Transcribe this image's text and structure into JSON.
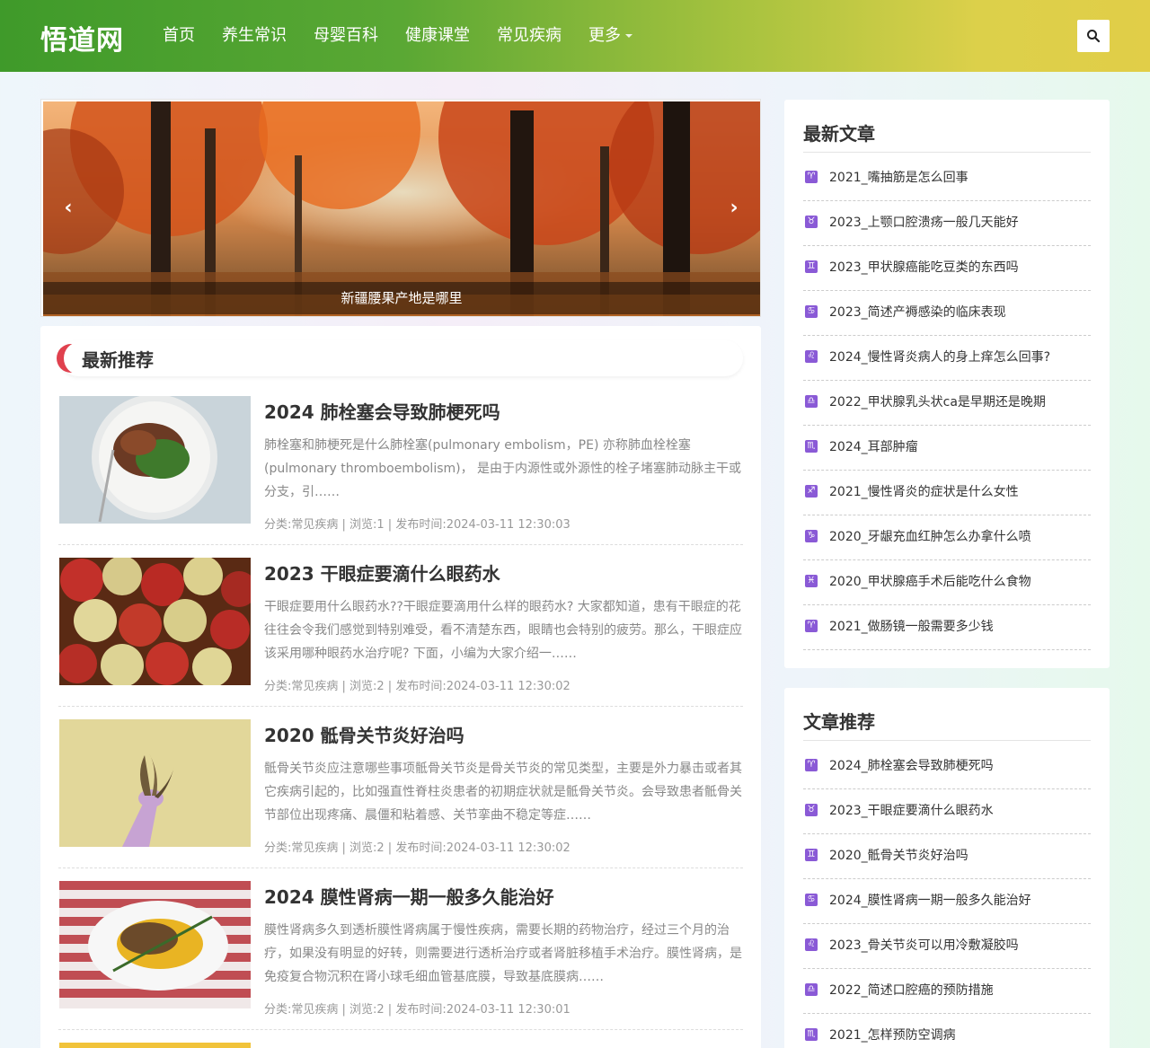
{
  "site": {
    "logo": "悟道网",
    "nav": [
      "首页",
      "养生常识",
      "母婴百科",
      "健康课堂",
      "常见疾病",
      "更多"
    ],
    "search_icon": "search-icon",
    "accent": "#e0414e",
    "header_gradient": [
      "#3f9a2a",
      "#e1ce48"
    ]
  },
  "slider": {
    "caption": "新疆腰果产地是哪里"
  },
  "main": {
    "section_title": "最新推荐",
    "posts": [
      {
        "title": "2024 肺栓塞会导致肺梗死吗",
        "excerpt": "肺栓塞和肺梗死是什么肺栓塞(pulmonary embolism，PE) 亦称肺血栓栓塞(pulmonary thromboembolism)， 是由于内源性或外源性的栓子堵塞肺动脉主干或分支，引……",
        "meta": "分类:常见疾病 | 浏览:1 | 发布时间:2024-03-11 12:30:03"
      },
      {
        "title": "2023 干眼症要滴什么眼药水",
        "excerpt": "干眼症要用什么眼药水??干眼症要滴用什么样的眼药水? 大家都知道，患有干眼症的花往往会令我们感觉到特别难受，看不清楚东西，眼睛也会特别的疲劳。那么，干眼症应该采用哪种眼药水治疗呢? 下面，小编为大家介绍一……",
        "meta": "分类:常见疾病 | 浏览:2 | 发布时间:2024-03-11 12:30:02"
      },
      {
        "title": "2020 骶骨关节炎好治吗",
        "excerpt": "骶骨关节炎应注意哪些事项骶骨关节炎是骨关节炎的常见类型，主要是外力暴击或者其它疾病引起的，比如强直性脊柱炎患者的初期症状就是骶骨关节炎。会导致患者骶骨关节部位出现疼痛、晨僵和粘着感、关节挛曲不稳定等症……",
        "meta": "分类:常见疾病 | 浏览:2 | 发布时间:2024-03-11 12:30:02"
      },
      {
        "title": "2024 膜性肾病一期一般多久能治好",
        "excerpt": "膜性肾病多久到透析膜性肾病属于慢性疾病，需要长期的药物治疗，经过三个月的治疗，如果没有明显的好转，则需要进行透析治疗或者肾脏移植手术治疗。膜性肾病，是免疫复合物沉积在肾小球毛细血管基底膜，导致基底膜病……",
        "meta": "分类:常见疾病 | 浏览:2 | 发布时间:2024-03-11 12:30:01"
      }
    ]
  },
  "sidebar": {
    "latest": {
      "title": "最新文章",
      "items": [
        {
          "zodiac": "♈",
          "text": "2021_嘴抽筋是怎么回事"
        },
        {
          "zodiac": "♉",
          "text": "2023_上颚口腔溃疡一般几天能好"
        },
        {
          "zodiac": "♊",
          "text": "2023_甲状腺癌能吃豆类的东西吗"
        },
        {
          "zodiac": "♋",
          "text": "2023_简述产褥感染的临床表现"
        },
        {
          "zodiac": "♌",
          "text": "2024_慢性肾炎病人的身上痒怎么回事?"
        },
        {
          "zodiac": "♎",
          "text": "2022_甲状腺乳头状ca是早期还是晚期"
        },
        {
          "zodiac": "♏",
          "text": "2024_耳部肿瘤"
        },
        {
          "zodiac": "♐",
          "text": "2021_慢性肾炎的症状是什么女性"
        },
        {
          "zodiac": "♑",
          "text": "2020_牙龈充血红肿怎么办拿什么喷"
        },
        {
          "zodiac": "♓",
          "text": "2020_甲状腺癌手术后能吃什么食物"
        },
        {
          "zodiac": "♈",
          "text": "2021_做肠镜一般需要多少钱"
        }
      ]
    },
    "recommend": {
      "title": "文章推荐",
      "items": [
        {
          "zodiac": "♈",
          "text": "2024_肺栓塞会导致肺梗死吗"
        },
        {
          "zodiac": "♉",
          "text": "2023_干眼症要滴什么眼药水"
        },
        {
          "zodiac": "♊",
          "text": "2020_骶骨关节炎好治吗"
        },
        {
          "zodiac": "♋",
          "text": "2024_膜性肾病一期一般多久能治好"
        },
        {
          "zodiac": "♌",
          "text": "2023_骨关节炎可以用冷敷凝胶吗"
        },
        {
          "zodiac": "♎",
          "text": "2022_简述口腔癌的预防措施"
        },
        {
          "zodiac": "♏",
          "text": "2021_怎样预防空调病"
        }
      ]
    }
  }
}
